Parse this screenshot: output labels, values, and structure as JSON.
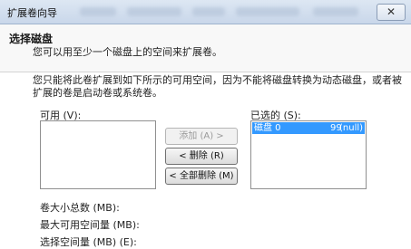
{
  "window": {
    "title": "扩展卷向导",
    "close_glyph": "✕"
  },
  "header": {
    "heading": "选择磁盘",
    "subheading": "您可以用至少一个磁盘上的空间来扩展卷。"
  },
  "main": {
    "description": "您只能将此卷扩展到如下所示的可用空间，因为不能将磁盘转换为动态磁盘，或者被扩展的卷是启动卷或系统卷。",
    "available_label": "可用 (V):",
    "selected_label": "已选的 (S):",
    "selected_items": [
      {
        "disk": "磁盘 0",
        "size": "99",
        "info": "(null)"
      }
    ],
    "buttons": {
      "add": "添加 (A) >",
      "remove": "< 删除 (R)",
      "remove_all": "< 全部删除 (M)"
    },
    "fields": {
      "total_size_label": "卷大小总数 (MB):",
      "max_space_label": "最大可用空间量 (MB):",
      "select_space_label": "选择空间量 (MB) (E):"
    }
  }
}
